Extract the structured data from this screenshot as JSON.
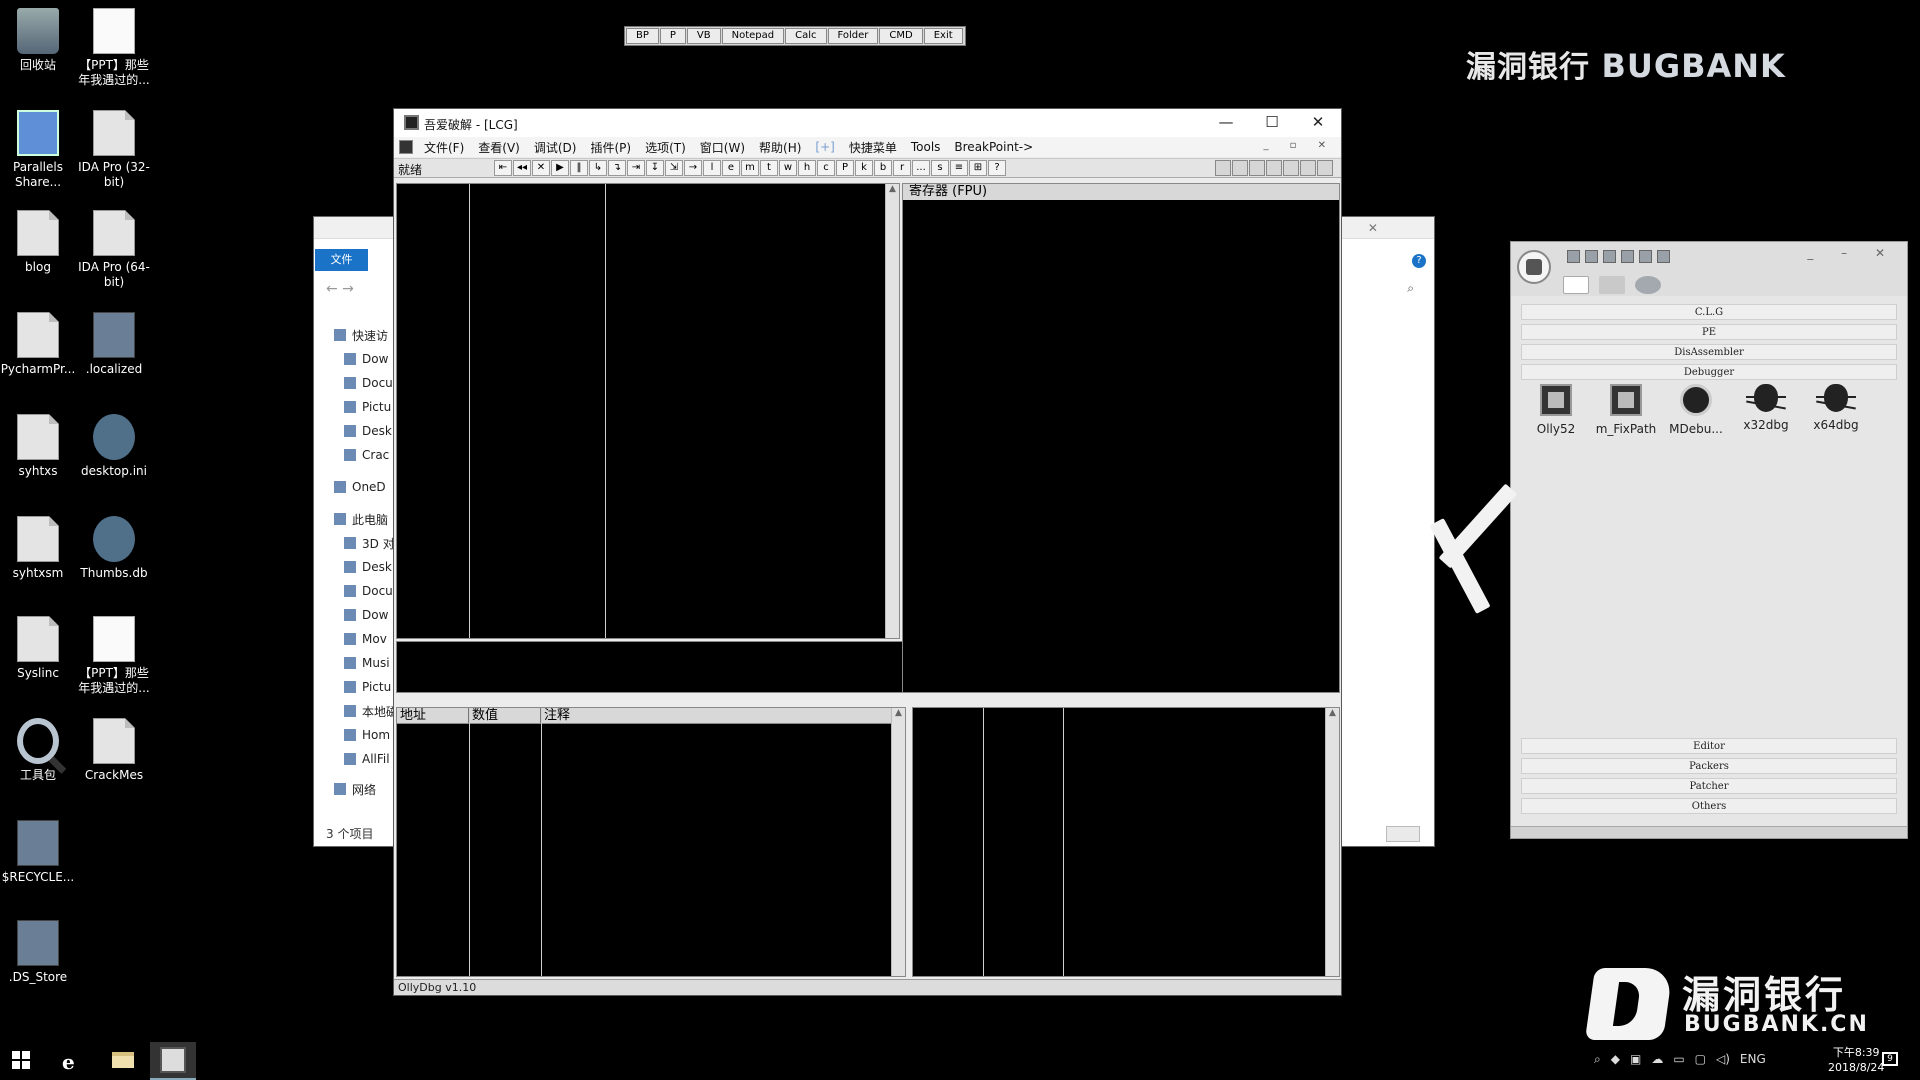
{
  "desktop": {
    "icons": [
      {
        "label": "回收站"
      },
      {
        "label": "【PPT】那些年我遇过的..."
      },
      {
        "label": "Parallels Share..."
      },
      {
        "label": "IDA Pro (32-bit)"
      },
      {
        "label": "blog"
      },
      {
        "label": "IDA Pro (64-bit)"
      },
      {
        "label": "PycharmPr..."
      },
      {
        "label": ".localized"
      },
      {
        "label": "syhtxs"
      },
      {
        "label": "desktop.ini"
      },
      {
        "label": "syhtxsm"
      },
      {
        "label": "Thumbs.db"
      },
      {
        "label": "Syslinc"
      },
      {
        "label": "【PPT】那些年我遇过的..."
      },
      {
        "label": "工具包"
      },
      {
        "label": "CrackMes"
      },
      {
        "label": "$RECYCLE..."
      },
      {
        "label": ".DS_Store"
      }
    ]
  },
  "launcher": {
    "buttons": [
      "BP",
      "P",
      "VB",
      "Notepad",
      "Calc",
      "Folder",
      "CMD",
      "Exit"
    ]
  },
  "watermark": {
    "top_cn": "漏洞银行",
    "top_en": "BUGBANK",
    "bottom_cn": "漏洞银行",
    "bottom_en": "BUGBANK.CN"
  },
  "explorer": {
    "file_tab": "文件",
    "nav_items": [
      "快速访",
      "Dow",
      "Docu",
      "Pictu",
      "Desk",
      "Crac",
      "OneD",
      "此电脑",
      "3D 对",
      "Desk",
      "Docu",
      "Dow",
      "Mov",
      "Musi",
      "Pictu",
      "本地磁",
      "Hom",
      "AllFil",
      "网络"
    ],
    "status": "3 个项目"
  },
  "olly": {
    "title": "吾爱破解 - [LCG]",
    "menu": [
      "文件(F)",
      "查看(V)",
      "调试(D)",
      "插件(P)",
      "选项(T)",
      "窗口(W)",
      "帮助(H)",
      "[+]",
      "快捷菜单",
      "Tools",
      "BreakPoint->"
    ],
    "toolbar_status": "就绪",
    "toolbar_buttons": [
      "⇤",
      "◂◂",
      "✕",
      "▶",
      "‖",
      "↳",
      "↴",
      "⇥",
      "↧",
      "⇲",
      "→",
      "l",
      "e",
      "m",
      "t",
      "w",
      "h",
      "c",
      "P",
      "k",
      "b",
      "r",
      "...",
      "s",
      "≡",
      "⊞",
      "?"
    ],
    "registers_title": "寄存器 (FPU)",
    "dump_headers": [
      "地址",
      "数值",
      "注释"
    ],
    "status_bar": "OllyDbg v1.10"
  },
  "lcg": {
    "categories_top": [
      "C.L.G",
      "PE",
      "DisAssembler",
      "Debugger"
    ],
    "apps": [
      {
        "label": "Olly52",
        "icon": "crack"
      },
      {
        "label": "m_FixPath",
        "icon": "crack"
      },
      {
        "label": "MDebu...",
        "icon": "bomb"
      },
      {
        "label": "x32dbg",
        "icon": "bug"
      },
      {
        "label": "x64dbg",
        "icon": "bug"
      }
    ],
    "categories_bottom": [
      "Editor",
      "Packers",
      "Patcher",
      "Others"
    ]
  },
  "taskbar": {
    "ime": "ENG",
    "clock_time": "下午8:39",
    "clock_date": "2018/8/24",
    "notification_count": "9"
  }
}
